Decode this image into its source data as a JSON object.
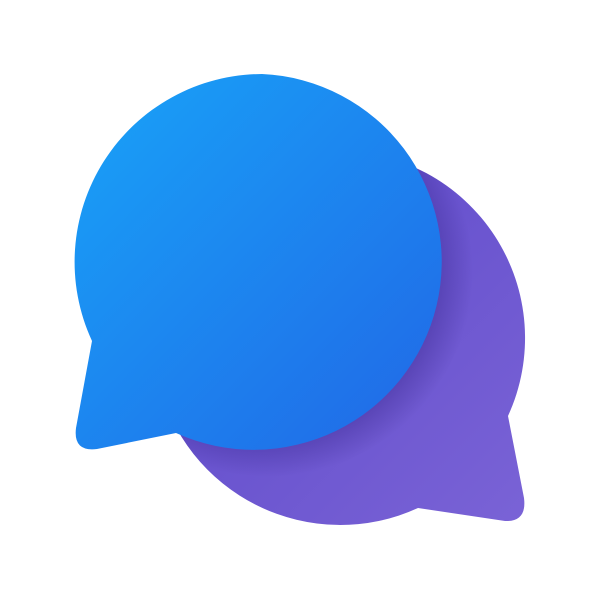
{
  "icon": {
    "name": "chat-bubbles-icon",
    "background": "#ffffff",
    "back_bubble": {
      "color_light": "#7a63d6",
      "color_dark": "#5a46c8"
    },
    "front_bubble": {
      "color_light": "#18a3f8",
      "color_dark": "#2167e6"
    }
  }
}
